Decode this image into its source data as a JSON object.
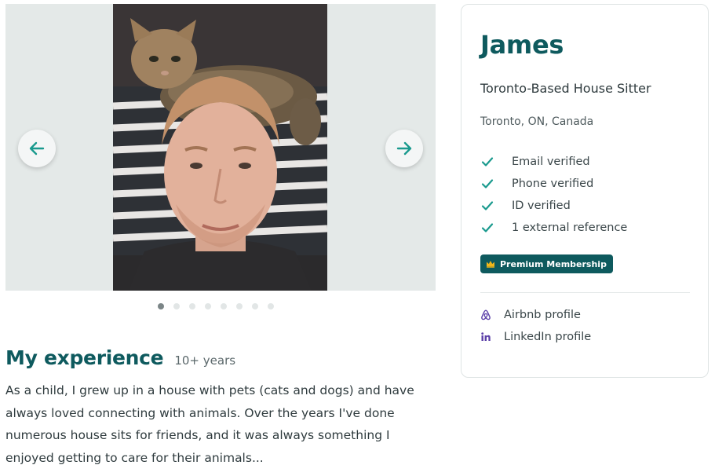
{
  "carousel": {
    "prev_icon": "arrow-left-icon",
    "next_icon": "arrow-right-icon",
    "dot_count": 8,
    "active_index": 0,
    "accent": "#1a9a8e"
  },
  "experience": {
    "title": "My experience",
    "years": "10+ years",
    "description": "As a child, I grew up in a house with pets (cats and dogs) and have always loved connecting with animals. Over the years I've done numerous house sits for friends, and it was always something I enjoyed getting to care for their animals..."
  },
  "profile": {
    "name": "James",
    "tagline": "Toronto-Based House Sitter",
    "location": "Toronto, ON, Canada",
    "verifications": [
      {
        "label": "Email verified",
        "icon": "check-icon"
      },
      {
        "label": "Phone verified",
        "icon": "check-icon"
      },
      {
        "label": "ID verified",
        "icon": "check-icon"
      },
      {
        "label": "1 external reference",
        "icon": "check-icon"
      }
    ],
    "badge": {
      "label": "Premium Membership",
      "icon": "crown-icon"
    },
    "links": [
      {
        "label": "Airbnb profile",
        "icon": "airbnb-icon"
      },
      {
        "label": "LinkedIn profile",
        "icon": "linkedin-icon"
      }
    ]
  },
  "colors": {
    "brand": "#0e5a5e",
    "check": "#1a9a8e",
    "crown": "#f2b619",
    "airbnb": "#5b3fa8",
    "linkedin": "#5b3fa8"
  }
}
